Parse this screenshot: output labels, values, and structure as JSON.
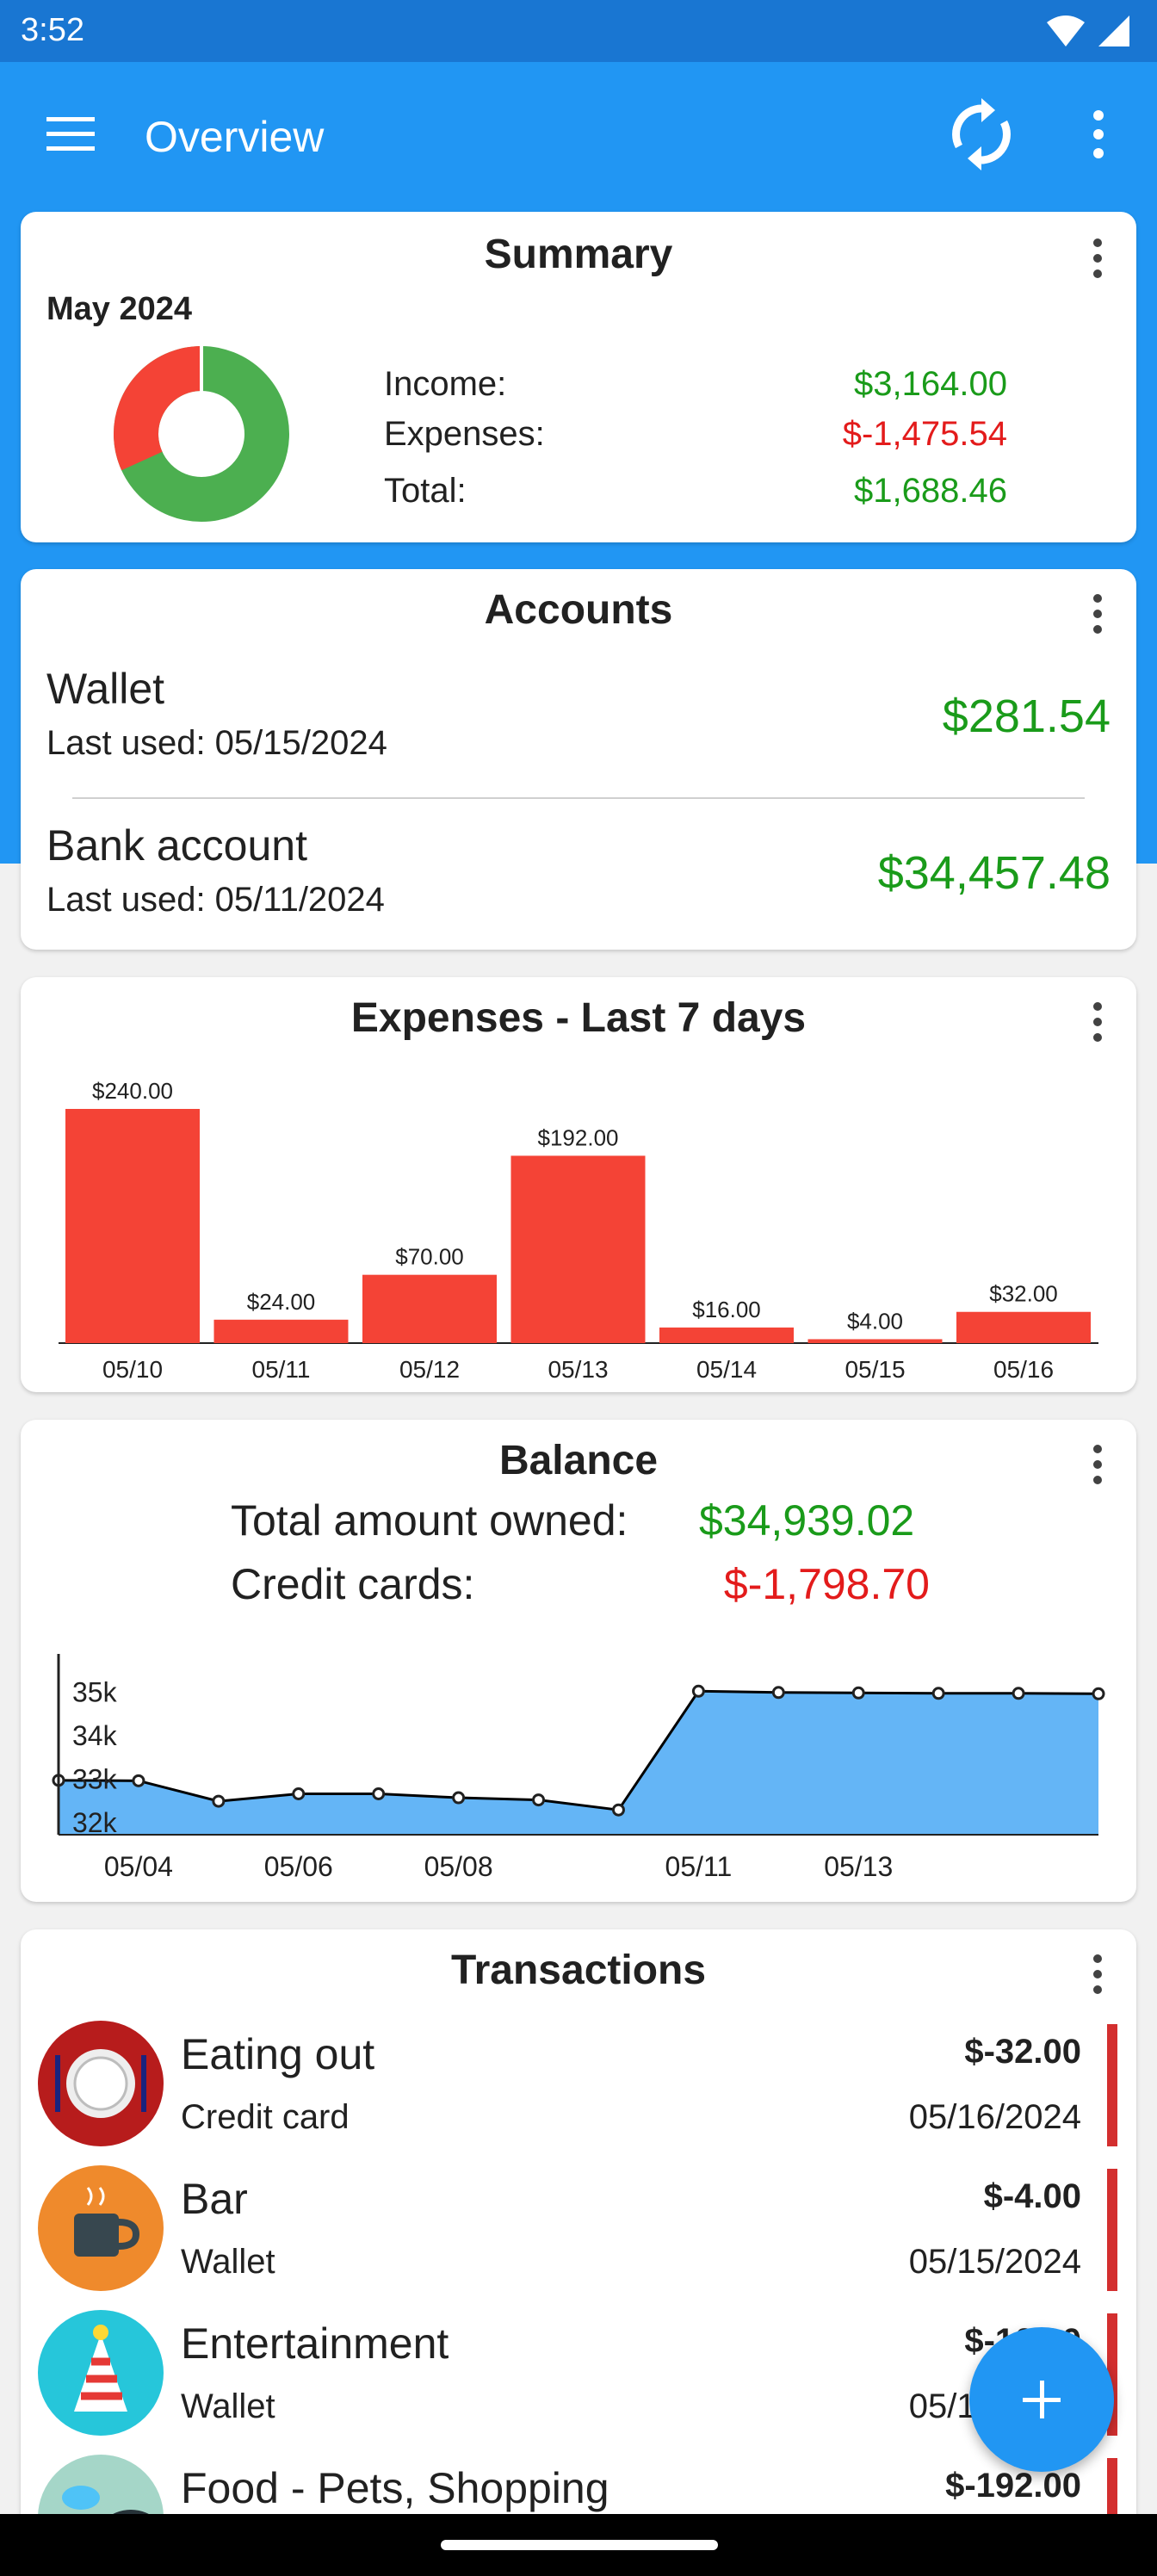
{
  "status_bar": {
    "time": "3:52"
  },
  "app_bar": {
    "title": "Overview"
  },
  "summary": {
    "title": "Summary",
    "period": "May 2024",
    "income_label": "Income:",
    "income_value": "$3,164.00",
    "expenses_label": "Expenses:",
    "expenses_value": "$-1,475.54",
    "total_label": "Total:",
    "total_value": "$1,688.46",
    "donut": {
      "expenses_share": 0.318,
      "expense_color": "#f44336",
      "income_color": "#4caf50"
    }
  },
  "accounts": {
    "title": "Accounts",
    "items": [
      {
        "name": "Wallet",
        "last_used": "Last used: 05/15/2024",
        "balance": "$281.54"
      },
      {
        "name": "Bank account",
        "last_used": "Last used: 05/11/2024",
        "balance": "$34,457.48"
      }
    ]
  },
  "expenses_chart": {
    "title": "Expenses - Last 7 days",
    "chart_data": {
      "type": "bar",
      "categories": [
        "05/10",
        "05/11",
        "05/12",
        "05/13",
        "05/14",
        "05/15",
        "05/16"
      ],
      "values": [
        240,
        24,
        70,
        192,
        16,
        4,
        32
      ],
      "value_labels": [
        "$240.00",
        "$24.00",
        "$70.00",
        "$192.00",
        "$16.00",
        "$4.00",
        "$32.00"
      ],
      "title": "Expenses - Last 7 days",
      "ylim": [
        0,
        240
      ],
      "color": "#f44336"
    }
  },
  "balance": {
    "title": "Balance",
    "owned_label": "Total amount owned:",
    "owned_value": "$34,939.02",
    "credit_label": "Credit cards:",
    "credit_value": "$-1,798.70",
    "chart_data": {
      "type": "area",
      "x": [
        "05/03",
        "05/04",
        "05/05",
        "05/06",
        "05/07",
        "05/08",
        "05/09",
        "05/10",
        "05/11",
        "05/12",
        "05/13",
        "05/14",
        "05/15",
        "05/16"
      ],
      "y": [
        32950,
        32940,
        32470,
        32640,
        32640,
        32550,
        32500,
        32270,
        35000,
        34970,
        34960,
        34950,
        34950,
        34940
      ],
      "x_tick_labels": [
        "05/04",
        "05/06",
        "05/08",
        "05/11",
        "05/13"
      ],
      "y_tick_labels": [
        "35k",
        "34k",
        "33k",
        "32k"
      ],
      "ylim": [
        31700,
        35500
      ],
      "fill_color": "#64b5f6",
      "line_color": "#000000"
    }
  },
  "transactions": {
    "title": "Transactions",
    "items": [
      {
        "category": "Eating out",
        "account": "Credit card",
        "amount": "$-32.00",
        "date": "05/16/2024",
        "icon": "plate-icon"
      },
      {
        "category": "Bar",
        "account": "Wallet",
        "amount": "$-4.00",
        "date": "05/15/2024",
        "icon": "mug-icon"
      },
      {
        "category": "Entertainment",
        "account": "Wallet",
        "amount": "$-16.00",
        "date": "05/14/2024",
        "icon": "party-hat-icon"
      },
      {
        "category": "Food - Pets, Shopping",
        "account": "",
        "amount": "$-192.00",
        "date": "",
        "icon": "pet-bowl-icon"
      }
    ]
  },
  "colors": {
    "primary": "#2196f3",
    "primary_dark": "#1976d2",
    "positive": "#1a9b1a",
    "negative": "#e31b1b",
    "bar": "#f44336"
  }
}
